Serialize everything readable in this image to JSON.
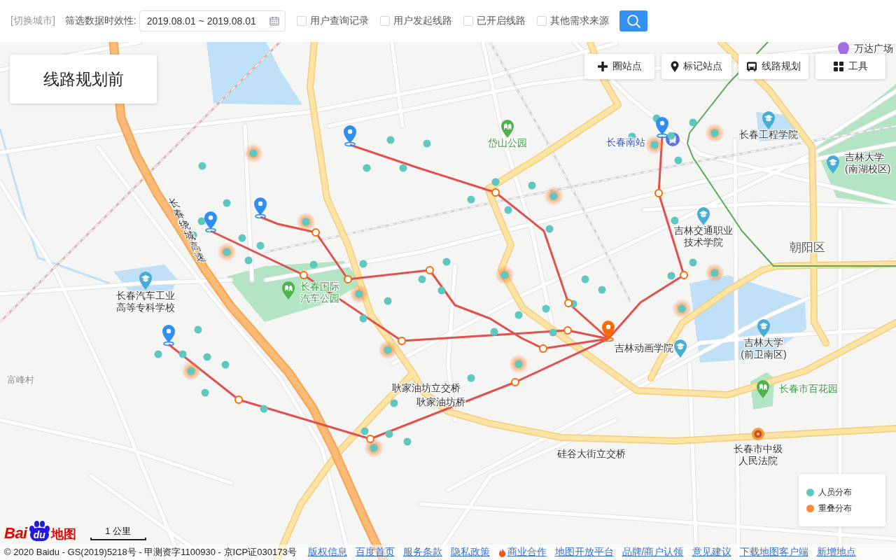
{
  "header": {
    "city_switch": "[切换城市]",
    "filter_label": "筛选数据时效性:",
    "date_range": {
      "value": "2019.08.01 ~ 2019.08.01"
    },
    "filters": [
      {
        "label": "用户查询记录",
        "checked": false
      },
      {
        "label": "用户发起线路",
        "checked": false
      },
      {
        "label": "已开启线路",
        "checked": false
      },
      {
        "label": "其他需求来源",
        "checked": false
      }
    ]
  },
  "map": {
    "title_card": "线路规划前",
    "tools": [
      {
        "label": "圈站点"
      },
      {
        "label": "标记站点"
      },
      {
        "label": "线路规划"
      },
      {
        "label": "工具"
      }
    ],
    "labels": [
      {
        "text": "万达广场",
        "kind": "mall"
      },
      {
        "text": "长春工程学院",
        "kind": "school"
      },
      {
        "text": "岱山公园",
        "kind": "park"
      },
      {
        "text": "长春南站",
        "kind": "station"
      },
      {
        "text": "吉林大学\n(南湖校区)",
        "kind": "school"
      },
      {
        "text": "长春绕城高速",
        "kind": "road"
      },
      {
        "text": "吉林交通职业技术学院",
        "kind": "school"
      },
      {
        "text": "朝阳区",
        "kind": "district"
      },
      {
        "text": "长春国际汽车公园",
        "kind": "park"
      },
      {
        "text": "长春汽车工业高等专科学校",
        "kind": "school"
      },
      {
        "text": "吉林动画学院",
        "kind": "school"
      },
      {
        "text": "吉林大学\n(前卫南区)",
        "kind": "school"
      },
      {
        "text": "富峰村",
        "kind": "village"
      },
      {
        "text": "耿家油坊立交桥",
        "kind": "place"
      },
      {
        "text": "长春市百花园",
        "kind": "park"
      },
      {
        "text": "耿家油坊桥",
        "kind": "place"
      },
      {
        "text": "硅谷大街立交桥",
        "kind": "place"
      },
      {
        "text": "长春市中级人民法院",
        "kind": "court"
      }
    ],
    "points": [
      {
        "overlap": true
      },
      {
        "overlap": false
      },
      {
        "overlap": false
      },
      {
        "overlap": false
      },
      {
        "overlap": false
      },
      {
        "overlap": false
      },
      {
        "overlap": false
      },
      {
        "overlap": false
      },
      {
        "overlap": false
      },
      {
        "overlap": false
      },
      {
        "overlap": false
      },
      {
        "overlap": true
      },
      {
        "overlap": false
      },
      {
        "overlap": true
      },
      {
        "overlap": false
      },
      {
        "overlap": false
      },
      {
        "overlap": false
      },
      {
        "overlap": false
      },
      {
        "overlap": false
      },
      {
        "overlap": true
      },
      {
        "overlap": false
      },
      {
        "overlap": false
      },
      {
        "overlap": false
      },
      {
        "overlap": false
      },
      {
        "overlap": true
      },
      {
        "overlap": false
      },
      {
        "overlap": false
      },
      {
        "overlap": false
      },
      {
        "overlap": true
      },
      {
        "overlap": false
      },
      {
        "overlap": false
      },
      {
        "overlap": false
      },
      {
        "overlap": false
      },
      {
        "overlap": false
      },
      {
        "overlap": false
      },
      {
        "overlap": false
      },
      {
        "overlap": true
      },
      {
        "overlap": true
      },
      {
        "overlap": false
      },
      {
        "overlap": false
      },
      {
        "overlap": false
      },
      {
        "overlap": false
      },
      {
        "overlap": false
      },
      {
        "overlap": true
      },
      {
        "overlap": false
      },
      {
        "overlap": false
      },
      {
        "overlap": false
      },
      {
        "overlap": false
      },
      {
        "overlap": false
      },
      {
        "overlap": true
      },
      {
        "overlap": false
      },
      {
        "overlap": false
      },
      {
        "overlap": false
      },
      {
        "overlap": false
      },
      {
        "overlap": false
      },
      {
        "overlap": false
      },
      {
        "overlap": true
      },
      {
        "overlap": true
      },
      {
        "overlap": false
      },
      {
        "overlap": false
      },
      {
        "overlap": false
      },
      {
        "overlap": true
      },
      {
        "overlap": false
      },
      {
        "overlap": true
      }
    ],
    "legend": {
      "items": [
        {
          "label": "人员分布",
          "color": "#5ec7bf"
        },
        {
          "label": "重叠分布",
          "color": "#f68b3c"
        }
      ]
    }
  },
  "footer": {
    "logo": {
      "text": "Bai",
      "paw_text": "du",
      "suffix": "地图"
    },
    "scale": "1 公里",
    "copyright": "© 2020 Baidu - GS(2019)5218号 - 甲测资字1100930 - 京ICP证030173号",
    "links": [
      {
        "label": "版权信息",
        "hot": false
      },
      {
        "label": "百度首页",
        "hot": false
      },
      {
        "label": "服务条款",
        "hot": false
      },
      {
        "label": "隐私政策",
        "hot": false
      },
      {
        "label": "商业合作",
        "hot": true
      },
      {
        "label": "地图开放平台",
        "hot": false
      },
      {
        "label": "品牌/商户认领",
        "hot": false
      },
      {
        "label": "意见建议",
        "hot": false
      },
      {
        "label": "下载地图客户端",
        "hot": false
      },
      {
        "label": "新增地点",
        "hot": false
      }
    ]
  }
}
